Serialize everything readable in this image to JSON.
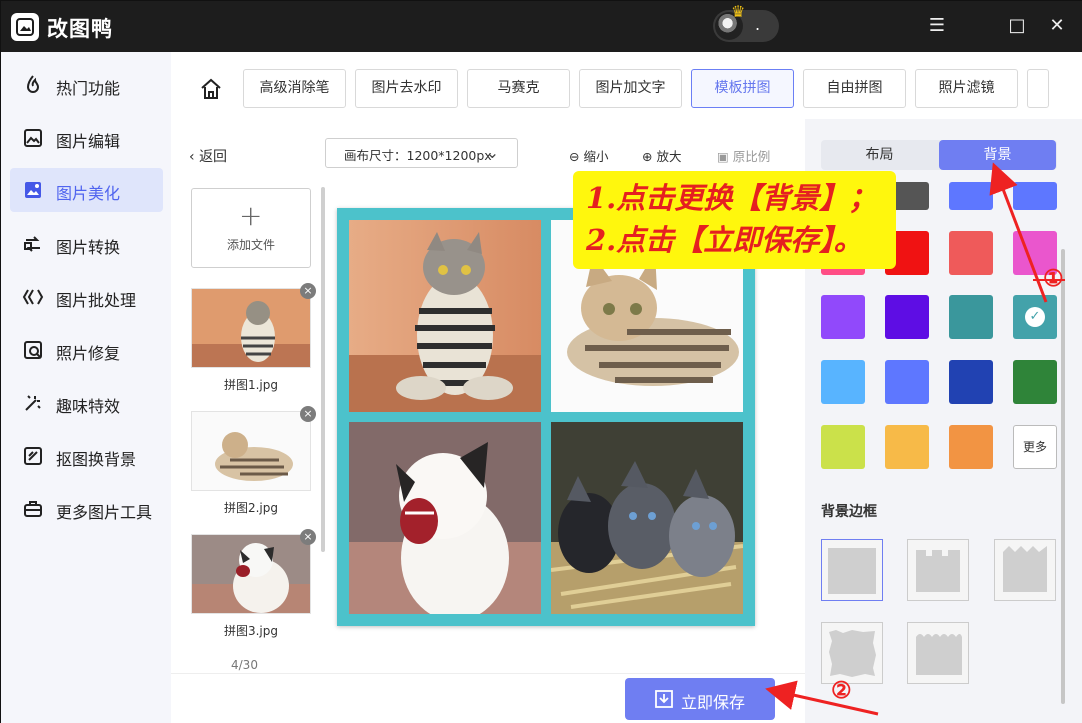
{
  "window": {
    "title": "改图鸭",
    "user_name": ".",
    "controls": [
      "☰",
      "□",
      "✕"
    ]
  },
  "sidebar": {
    "items": [
      {
        "label": "热门功能",
        "icon": "flame-icon"
      },
      {
        "label": "图片编辑",
        "icon": "image-edit-icon"
      },
      {
        "label": "图片美化",
        "icon": "image-beautify-icon",
        "active": true
      },
      {
        "label": "图片转换",
        "icon": "convert-icon"
      },
      {
        "label": "图片批处理",
        "icon": "batch-icon"
      },
      {
        "label": "照片修复",
        "icon": "photo-repair-icon"
      },
      {
        "label": "趣味特效",
        "icon": "magic-icon"
      },
      {
        "label": "抠图换背景",
        "icon": "cutout-icon"
      },
      {
        "label": "更多图片工具",
        "icon": "toolbox-icon"
      }
    ]
  },
  "top_nav": {
    "items": [
      "高级消除笔",
      "图片去水印",
      "马赛克",
      "图片加文字",
      "模板拼图",
      "自由拼图",
      "照片滤镜"
    ],
    "active": "模板拼图"
  },
  "toolbar": {
    "back": "返回",
    "canvas_size": "画布尺寸：1200*1200px",
    "zoom_out": "缩小",
    "zoom_in": "放大",
    "original_ratio": "原比例"
  },
  "files": {
    "add_label": "添加文件",
    "items": [
      "拼图1.jpg",
      "拼图2.jpg",
      "拼图3.jpg"
    ],
    "page_current": "4",
    "page_total": "/30"
  },
  "right_panel": {
    "tabs": [
      "布局",
      "背景"
    ],
    "active_tab": "背景",
    "swatches": [
      "#ff4d86",
      "#f01212",
      "#ef5a5a",
      "#ea56cd",
      "#9149fb",
      "#5e0de4",
      "#3a979c",
      "#43a2aa",
      "#58b4ff",
      "#5e77ff",
      "#2142b2",
      "#2f8439",
      "#cbe14a",
      "#f7ba48",
      "#f29443"
    ],
    "top_partial_swatches": [
      "#000000",
      "#555555",
      "#5e77ff"
    ],
    "selected_swatch": "#43a2aa",
    "more": "更多",
    "border_title": "背景边框"
  },
  "actions": {
    "save": "立即保存"
  },
  "annotation": {
    "line1": "1.点击更换【背景】；",
    "line2": "2.点击【立即保存】。",
    "marker1": "①",
    "marker2": "②"
  },
  "colors": {
    "accent": "#6f7ef2",
    "canvas_background": "#4cc2cb",
    "annotation": "#e52020",
    "highlight": "#fff70d"
  }
}
